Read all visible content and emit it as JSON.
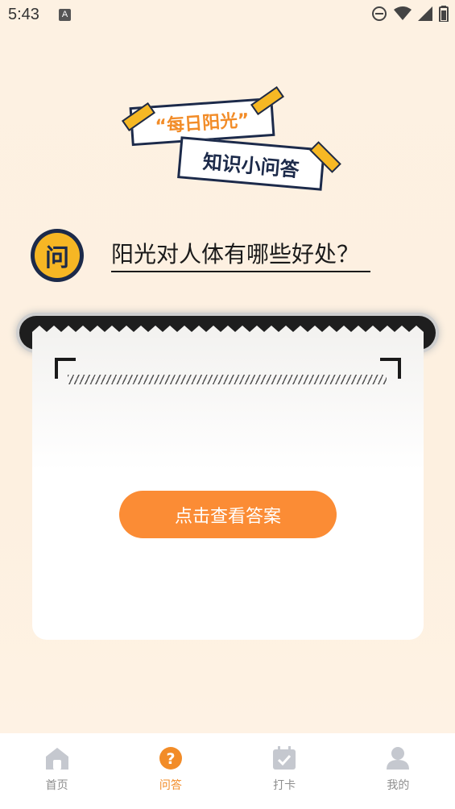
{
  "status_bar": {
    "time": "5:43",
    "notification_glyph": "A"
  },
  "banner": {
    "line1": "“每日阳光”",
    "line2": "知识小问答"
  },
  "question": {
    "badge": "问",
    "text": "阳光对人体有哪些好处？"
  },
  "answer_card": {
    "reveal_button": "点击查看答案"
  },
  "nav": {
    "items": [
      {
        "label": "首页",
        "icon": "home-icon",
        "active": false
      },
      {
        "label": "问答",
        "icon": "question-icon",
        "active": true
      },
      {
        "label": "打卡",
        "icon": "calendar-check-icon",
        "active": false
      },
      {
        "label": "我的",
        "icon": "user-icon",
        "active": false
      }
    ]
  },
  "colors": {
    "accent": "#f28c28",
    "navy": "#1c2a4a",
    "yellow": "#f6b624",
    "button": "#fb8c35",
    "inactive": "#c5c8cf"
  }
}
